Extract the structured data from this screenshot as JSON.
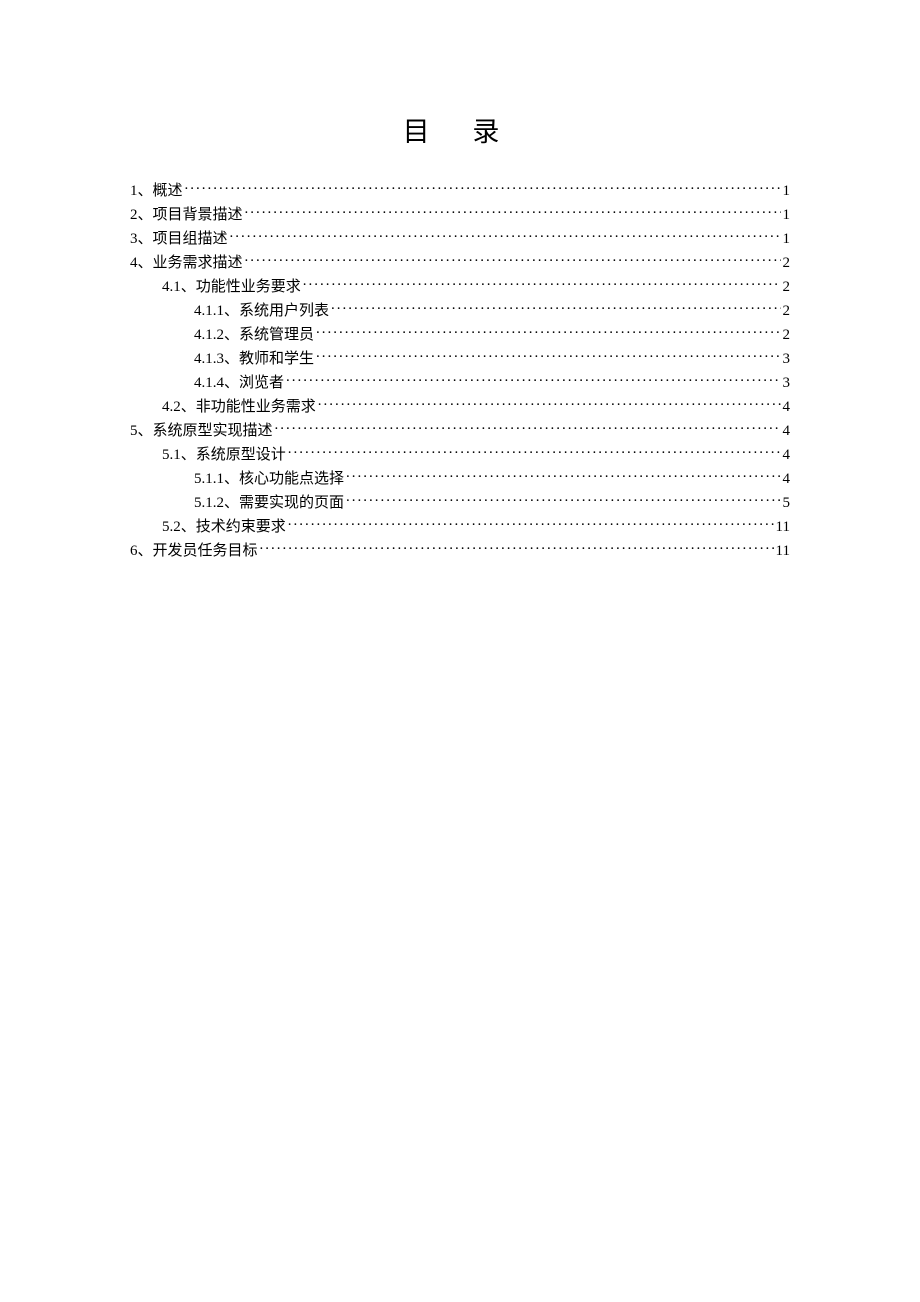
{
  "title": "目 录",
  "toc": [
    {
      "level": 0,
      "label": "1、概述",
      "page": "1"
    },
    {
      "level": 0,
      "label": "2、项目背景描述",
      "page": "1"
    },
    {
      "level": 0,
      "label": "3、项目组描述",
      "page": "1"
    },
    {
      "level": 0,
      "label": "4、业务需求描述",
      "page": "2"
    },
    {
      "level": 1,
      "label": "4.1、功能性业务要求",
      "page": "2"
    },
    {
      "level": 2,
      "label": "4.1.1、系统用户列表",
      "page": "2"
    },
    {
      "level": 2,
      "label": "4.1.2、系统管理员",
      "page": "2"
    },
    {
      "level": 2,
      "label": "4.1.3、教师和学生",
      "page": "3"
    },
    {
      "level": 2,
      "label": "4.1.4、浏览者",
      "page": "3"
    },
    {
      "level": 1,
      "label": "4.2、非功能性业务需求",
      "page": "4"
    },
    {
      "level": 0,
      "label": "5、系统原型实现描述",
      "page": "4"
    },
    {
      "level": 1,
      "label": "5.1、系统原型设计",
      "page": "4"
    },
    {
      "level": 2,
      "label": "5.1.1、核心功能点选择",
      "page": "4"
    },
    {
      "level": 2,
      "label": "5.1.2、需要实现的页面",
      "page": "5"
    },
    {
      "level": 1,
      "label": "5.2、技术约束要求",
      "page": "11"
    },
    {
      "level": 0,
      "label": "6、开发员任务目标",
      "page": "11"
    }
  ]
}
